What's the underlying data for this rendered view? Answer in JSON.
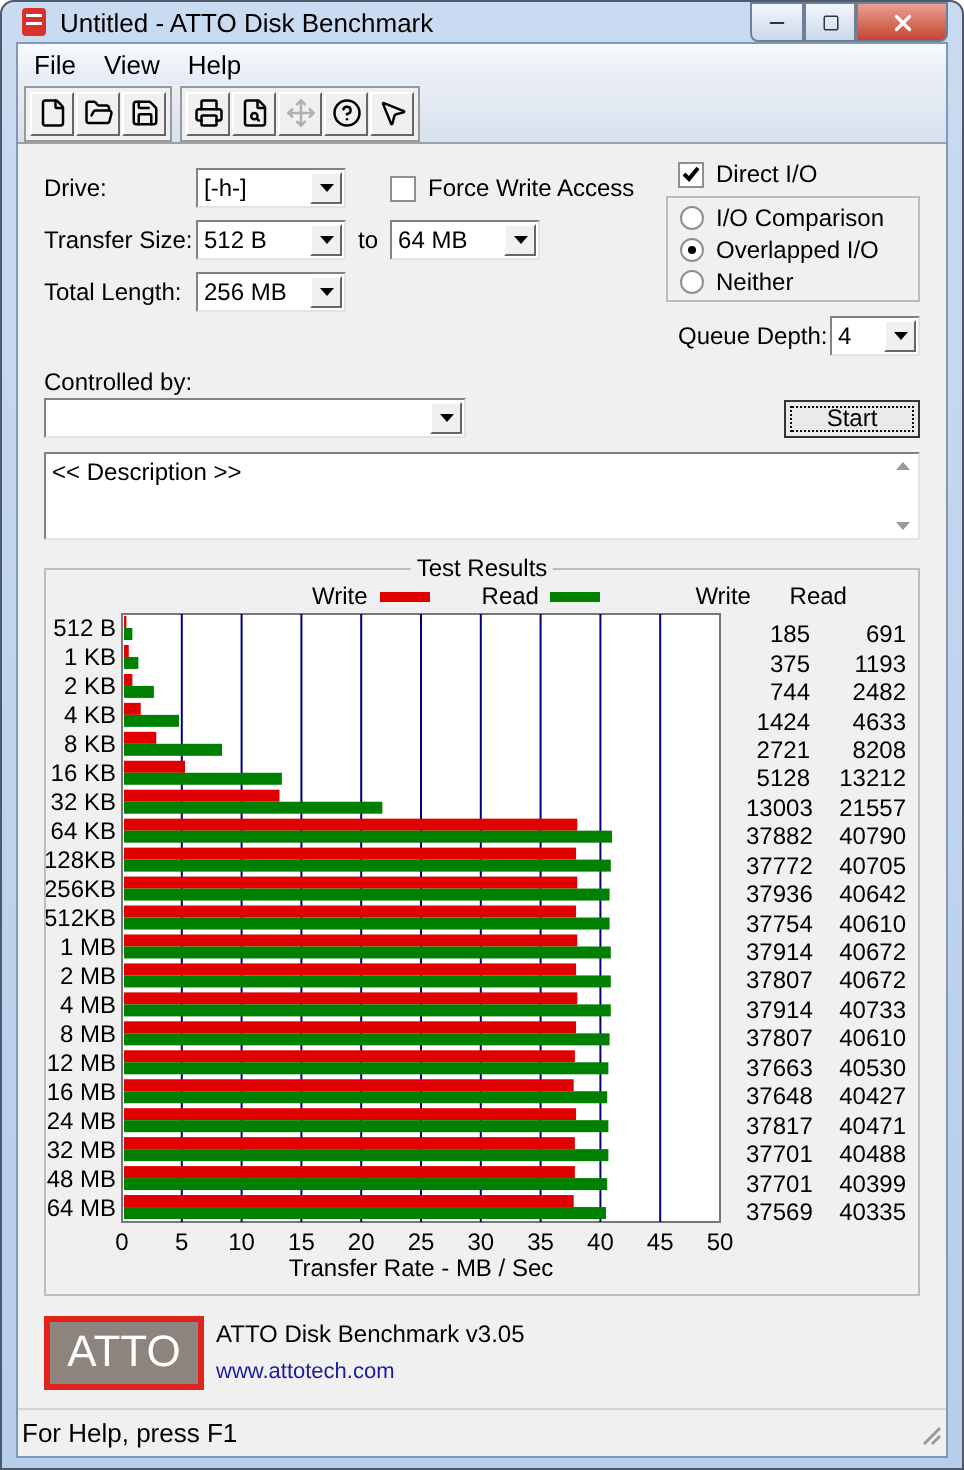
{
  "window": {
    "title": "Untitled - ATTO Disk Benchmark"
  },
  "menu": [
    "File",
    "View",
    "Help"
  ],
  "toolbar": [
    {
      "kind": "new",
      "disabled": false
    },
    {
      "kind": "open",
      "disabled": false
    },
    {
      "kind": "save",
      "disabled": false
    },
    {
      "kind": "print",
      "disabled": false
    },
    {
      "kind": "preview",
      "disabled": false
    },
    {
      "kind": "move",
      "disabled": true
    },
    {
      "kind": "help",
      "disabled": false
    },
    {
      "kind": "context-help",
      "disabled": false
    }
  ],
  "settings": {
    "drive": {
      "label": "Drive:",
      "value": "[-h-]"
    },
    "transfer_size": {
      "label": "Transfer Size:",
      "from": "512 B",
      "to_label": "to",
      "to": "64 MB"
    },
    "total_length": {
      "label": "Total Length:",
      "value": "256 MB"
    },
    "force_write_access": {
      "label": "Force Write Access",
      "checked": false
    },
    "direct_io": {
      "label": "Direct I/O",
      "checked": true
    },
    "io_modes": [
      {
        "label": "I/O Comparison",
        "selected": false
      },
      {
        "label": "Overlapped I/O",
        "selected": true
      },
      {
        "label": "Neither",
        "selected": false
      }
    ],
    "queue_depth": {
      "label": "Queue Depth:",
      "value": "4"
    },
    "controlled_by": {
      "label": "Controlled by:"
    }
  },
  "start_button": "Start",
  "description": "<< Description >>",
  "results": {
    "title": "Test Results",
    "columns": [
      "Write",
      "Read"
    ],
    "rows": [
      {
        "write": "185",
        "read": "691"
      },
      {
        "write": "375",
        "read": "1193"
      },
      {
        "write": "744",
        "read": "2482"
      },
      {
        "write": "1424",
        "read": "4633"
      },
      {
        "write": "2721",
        "read": "8208"
      },
      {
        "write": "5128",
        "read": "13212"
      },
      {
        "write": "13003",
        "read": "21557"
      },
      {
        "write": "37882",
        "read": "40790"
      },
      {
        "write": "37772",
        "read": "40705"
      },
      {
        "write": "37936",
        "read": "40642"
      },
      {
        "write": "37754",
        "read": "40610"
      },
      {
        "write": "37914",
        "read": "40672"
      },
      {
        "write": "37807",
        "read": "40672"
      },
      {
        "write": "37914",
        "read": "40733"
      },
      {
        "write": "37807",
        "read": "40610"
      },
      {
        "write": "37663",
        "read": "40530"
      },
      {
        "write": "37648",
        "read": "40427"
      },
      {
        "write": "37817",
        "read": "40471"
      },
      {
        "write": "37701",
        "read": "40488"
      },
      {
        "write": "37701",
        "read": "40399"
      },
      {
        "write": "37569",
        "read": "40335"
      }
    ],
    "chart_data": {
      "type": "bar",
      "orientation": "horizontal",
      "xlabel": "Transfer Rate - MB / Sec",
      "categories": [
        "512 B",
        "1 KB",
        "2 KB",
        "4 KB",
        "8 KB",
        "16 KB",
        "32 KB",
        "64 KB",
        "128KB",
        "256KB",
        "512KB",
        "1 MB",
        "2 MB",
        "4 MB",
        "8 MB",
        "12 MB",
        "16 MB",
        "24 MB",
        "32 MB",
        "48 MB",
        "64 MB"
      ],
      "series": [
        {
          "name": "Write",
          "color": "#e00000",
          "values": [
            0.2,
            0.4,
            0.7,
            1.4,
            2.7,
            5.1,
            13.0,
            37.9,
            37.8,
            37.9,
            37.8,
            37.9,
            37.8,
            37.9,
            37.8,
            37.7,
            37.6,
            37.8,
            37.7,
            37.7,
            37.6
          ]
        },
        {
          "name": "Read",
          "color": "#008000",
          "values": [
            0.7,
            1.2,
            2.5,
            4.6,
            8.2,
            13.2,
            21.6,
            40.8,
            40.7,
            40.6,
            40.6,
            40.7,
            40.7,
            40.7,
            40.6,
            40.5,
            40.4,
            40.5,
            40.5,
            40.4,
            40.3
          ]
        }
      ],
      "grid": true,
      "xlim": [
        0,
        50
      ],
      "xticks": [
        0,
        5,
        10,
        15,
        20,
        25,
        30,
        35,
        40,
        45,
        50
      ]
    }
  },
  "footer": {
    "logo": "ATTO",
    "product": "ATTO Disk Benchmark v3.05",
    "link": "www.attotech.com"
  },
  "status_bar": "For Help, press F1"
}
